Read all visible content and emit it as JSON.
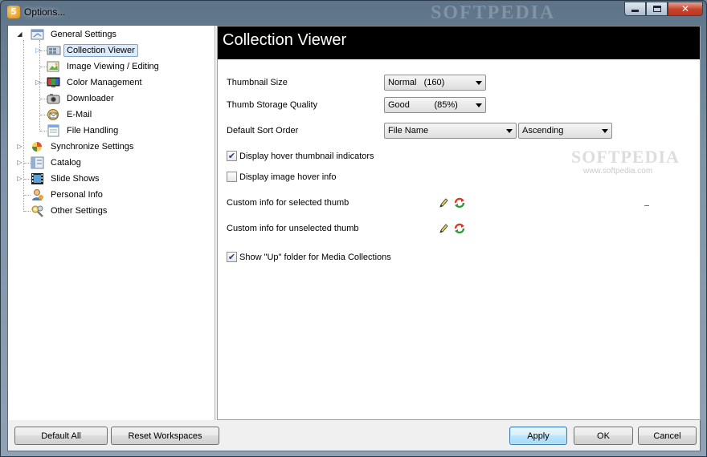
{
  "window": {
    "title": "Options...",
    "app_icon": "5",
    "watermark": "SOFTPEDIA",
    "controls": {
      "close_glyph": "✕"
    }
  },
  "tree": {
    "items": [
      {
        "label": "General Settings",
        "icon": "settings-window-icon",
        "expanded": true
      },
      {
        "label": "Collection Viewer",
        "icon": "collection-viewer-icon",
        "selected": true
      },
      {
        "label": "Image Viewing / Editing",
        "icon": "image-edit-icon"
      },
      {
        "label": "Color Management",
        "icon": "color-monitor-icon"
      },
      {
        "label": "Downloader",
        "icon": "camera-icon"
      },
      {
        "label": "E-Mail",
        "icon": "email-icon"
      },
      {
        "label": "File Handling",
        "icon": "file-handling-icon"
      },
      {
        "label": "Synchronize Settings",
        "icon": "sync-icon"
      },
      {
        "label": "Catalog",
        "icon": "catalog-icon"
      },
      {
        "label": "Slide Shows",
        "icon": "film-icon"
      },
      {
        "label": "Personal Info",
        "icon": "person-icon"
      },
      {
        "label": "Other Settings",
        "icon": "tools-icon"
      }
    ]
  },
  "content": {
    "title": "Collection Viewer",
    "watermark": "SOFTPEDIA",
    "watermark_url": "www.softpedia.com",
    "thumbnail_size": {
      "label": "Thumbnail Size",
      "value": "Normal   (160)"
    },
    "thumb_quality": {
      "label": "Thumb Storage Quality",
      "value": "Good          (85%)"
    },
    "sort_order": {
      "label": "Default Sort Order",
      "field": "File Name",
      "direction": "Ascending"
    },
    "hover_indicators": {
      "label": "Display hover thumbnail indicators",
      "checked": true
    },
    "hover_info": {
      "label": "Display image hover info",
      "checked": false
    },
    "custom_selected": {
      "label": "Custom info for selected thumb"
    },
    "custom_unselected": {
      "label": "Custom info for unselected thumb"
    },
    "show_up_folder": {
      "label": "Show \"Up\" folder for Media Collections",
      "checked": true
    },
    "check_glyph": "✔"
  },
  "buttons": {
    "default_all": "Default All",
    "reset_workspaces": "Reset Workspaces",
    "apply": "Apply",
    "ok": "OK",
    "cancel": "Cancel"
  },
  "colors": {
    "selection_bg": "#dcebfc",
    "selection_border": "#7da2ce",
    "header_bg": "#000000",
    "default_button": "#3c7fb1"
  }
}
